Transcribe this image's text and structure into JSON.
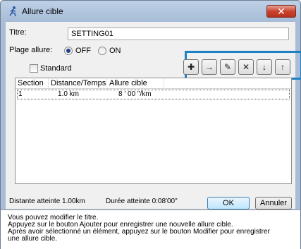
{
  "window": {
    "title": "Allure cible",
    "close_label": "✕"
  },
  "form": {
    "titre_label": "Titre:",
    "titre_value": "SETTING01",
    "plage_label": "Plage allure:",
    "off_label": "OFF",
    "on_label": "ON",
    "selected_plage": "OFF",
    "standard_label": "Standard",
    "standard_checked": false
  },
  "toolbar": {
    "buttons": [
      {
        "name": "add-button",
        "glyph": "✚"
      },
      {
        "name": "insert-button",
        "glyph": "→"
      },
      {
        "name": "edit-button",
        "glyph": "✎"
      },
      {
        "name": "delete-button",
        "glyph": "✕"
      },
      {
        "name": "move-down-button",
        "glyph": "↓"
      },
      {
        "name": "move-up-button",
        "glyph": "↑"
      }
    ]
  },
  "table": {
    "columns": [
      "Section",
      "Distance/Temps",
      "Allure cible"
    ],
    "rows": [
      {
        "section": "1",
        "distance": "1.0 km",
        "allure": "8 ' 00 \"/km"
      }
    ]
  },
  "footer": {
    "distance_atteinte": "Distante atteinte  1.00km",
    "duree_atteinte": "Durée atteinte  0:08'00\"",
    "ok_label": "OK",
    "cancel_label": "Annuler"
  },
  "help": {
    "lines": [
      "Vous pouvez modifier le titre.",
      "Appuyez sur le bouton Ajouter pour enregistrer une nouvelle allure cible.",
      "Après avoir sélectionné un élément, appuyez sur le bouton Modifier pour enregistrer",
      "une allure cible."
    ]
  },
  "colors": {
    "highlight": "#1f7fc3",
    "title_bar": "#a9bed6",
    "close": "#c8432e"
  }
}
